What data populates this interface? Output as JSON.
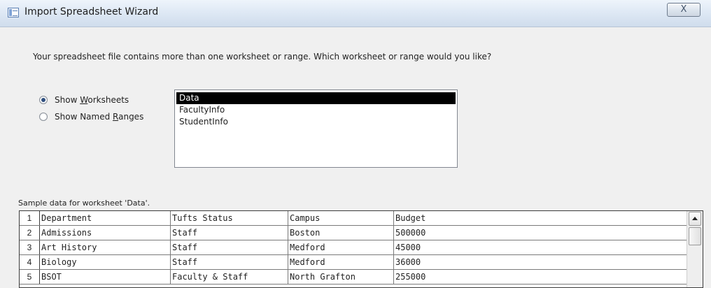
{
  "window": {
    "title": "Import Spreadsheet Wizard",
    "icon": "table-icon",
    "close_glyph": "X"
  },
  "prompt": "Your spreadsheet file contains more than one worksheet or range. Which worksheet or range would you like?",
  "options": {
    "show_worksheets": {
      "pre": "Show ",
      "accel": "W",
      "post": "orksheets",
      "checked": true
    },
    "show_named_ranges": {
      "pre": "Show Named ",
      "accel": "R",
      "post": "anges",
      "checked": false
    }
  },
  "worksheets": {
    "items": [
      "Data",
      "FacultyInfo",
      "StudentInfo"
    ],
    "selected": "Data"
  },
  "sample": {
    "label": "Sample data for worksheet 'Data'.",
    "rows": [
      {
        "num": "1",
        "cells": [
          "Department",
          "Tufts Status",
          "Campus",
          "Budget"
        ]
      },
      {
        "num": "2",
        "cells": [
          "Admissions",
          "Staff",
          "Boston",
          "500000"
        ]
      },
      {
        "num": "3",
        "cells": [
          "Art History",
          "Staff",
          "Medford",
          "45000"
        ]
      },
      {
        "num": "4",
        "cells": [
          "Biology",
          "Staff",
          "Medford",
          "36000"
        ]
      },
      {
        "num": "5",
        "cells": [
          "BSOT",
          "Faculty & Staff",
          "North Grafton",
          "255000"
        ]
      }
    ]
  }
}
